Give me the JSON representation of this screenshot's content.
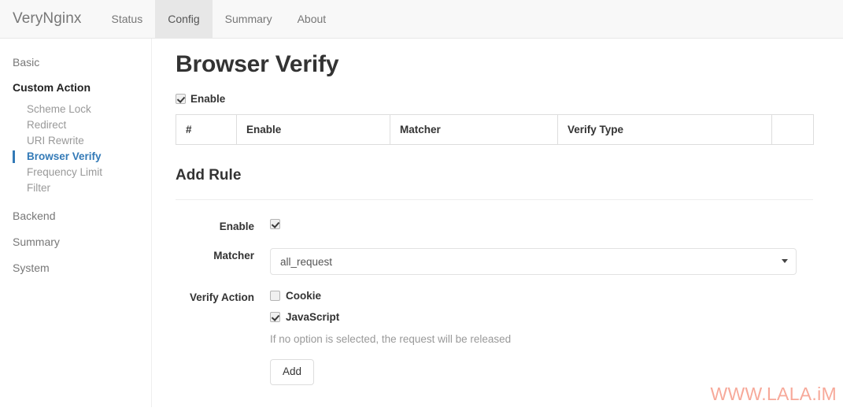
{
  "navbar": {
    "brand": "VeryNginx",
    "items": [
      {
        "label": "Status",
        "active": false
      },
      {
        "label": "Config",
        "active": true
      },
      {
        "label": "Summary",
        "active": false
      },
      {
        "label": "About",
        "active": false
      }
    ]
  },
  "sidebar": {
    "basic": "Basic",
    "group_title": "Custom Action",
    "sub_items": [
      {
        "label": "Scheme Lock",
        "active": false
      },
      {
        "label": "Redirect",
        "active": false
      },
      {
        "label": "URI Rewrite",
        "active": false
      },
      {
        "label": "Browser Verify",
        "active": true
      },
      {
        "label": "Frequency Limit",
        "active": false
      },
      {
        "label": "Filter",
        "active": false
      }
    ],
    "backend": "Backend",
    "summary": "Summary",
    "system": "System"
  },
  "main": {
    "title": "Browser Verify",
    "enable_label": "Enable",
    "enable_checked": true,
    "table": {
      "columns": [
        "#",
        "Enable",
        "Matcher",
        "Verify Type",
        ""
      ],
      "rows": []
    },
    "add_rule": {
      "section_title": "Add Rule",
      "enable_label": "Enable",
      "enable_checked": true,
      "matcher_label": "Matcher",
      "matcher_value": "all_request",
      "matcher_options": [
        "all_request"
      ],
      "verify_action_label": "Verify Action",
      "verify_options": [
        {
          "label": "Cookie",
          "checked": false
        },
        {
          "label": "JavaScript",
          "checked": true
        }
      ],
      "hint": "If no option is selected, the request will be released",
      "add_button": "Add"
    }
  },
  "watermark": "WWW.LALA.iM",
  "colors": {
    "accent": "#337ab7",
    "navbar_bg": "#f8f8f8",
    "active_tab_bg": "#e7e7e7",
    "watermark": "#f7a99a"
  }
}
